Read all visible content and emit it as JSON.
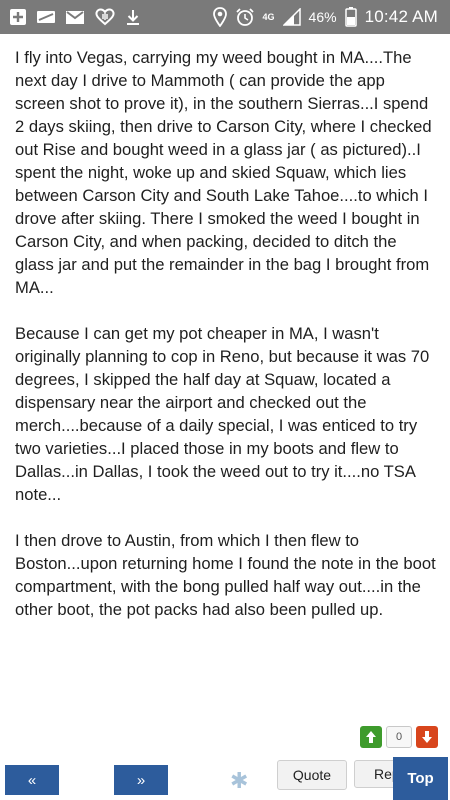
{
  "status_bar": {
    "network_label": "4G",
    "battery": "46%",
    "time": "10:42 AM"
  },
  "post": {
    "paragraphs": [
      "I fly into Vegas, carrying my weed bought in MA....The next day I drive to Mammoth ( can provide the app screen shot to prove it), in the southern Sierras...I spend 2 days skiing, then drive to Carson City, where I checked out Rise and bought weed in a glass jar ( as pictured)..I spent the night, woke up and skied Squaw, which lies between Carson City and South Lake Tahoe....to which I drove after skiing. There I smoked the weed I bought in Carson City, and when packing, decided to ditch the glass jar and put the remainder in the bag I brought from MA...",
      "Because I can get my pot cheaper in MA, I wasn't originally planning to cop in Reno, but because it was 70 degrees, I skipped the half day at Squaw, located a dispensary near the airport and checked out the merch....because of a daily special, I was enticed to try two varieties...I placed those in my boots and flew to Dallas...in Dallas, I took the weed out to try it....no TSA note...",
      "I then drove to Austin, from which I then flew to Boston...upon returning home I found the note in the boot compartment, with the bong pulled half way out....in the other boot, the pot packs had also been pulled up."
    ]
  },
  "vote": {
    "count": "0"
  },
  "bottom_bar": {
    "prev_label": "«",
    "next_label": "»",
    "quote_label": "Quote",
    "reply_label": "Reply",
    "top_label": "Top"
  },
  "colors": {
    "status_bar": "#7a7a7a",
    "nav_blue": "#2d5c9c",
    "upvote_green": "#3e9b2c",
    "downvote_red": "#d8451c"
  },
  "icons": [
    "add-box-icon",
    "tape-icon",
    "gmail-icon",
    "iheart-icon",
    "download-icon",
    "location-icon",
    "alarm-icon",
    "signal-icon",
    "battery-icon",
    "star-icon",
    "arrow-up-icon",
    "arrow-down-icon"
  ]
}
